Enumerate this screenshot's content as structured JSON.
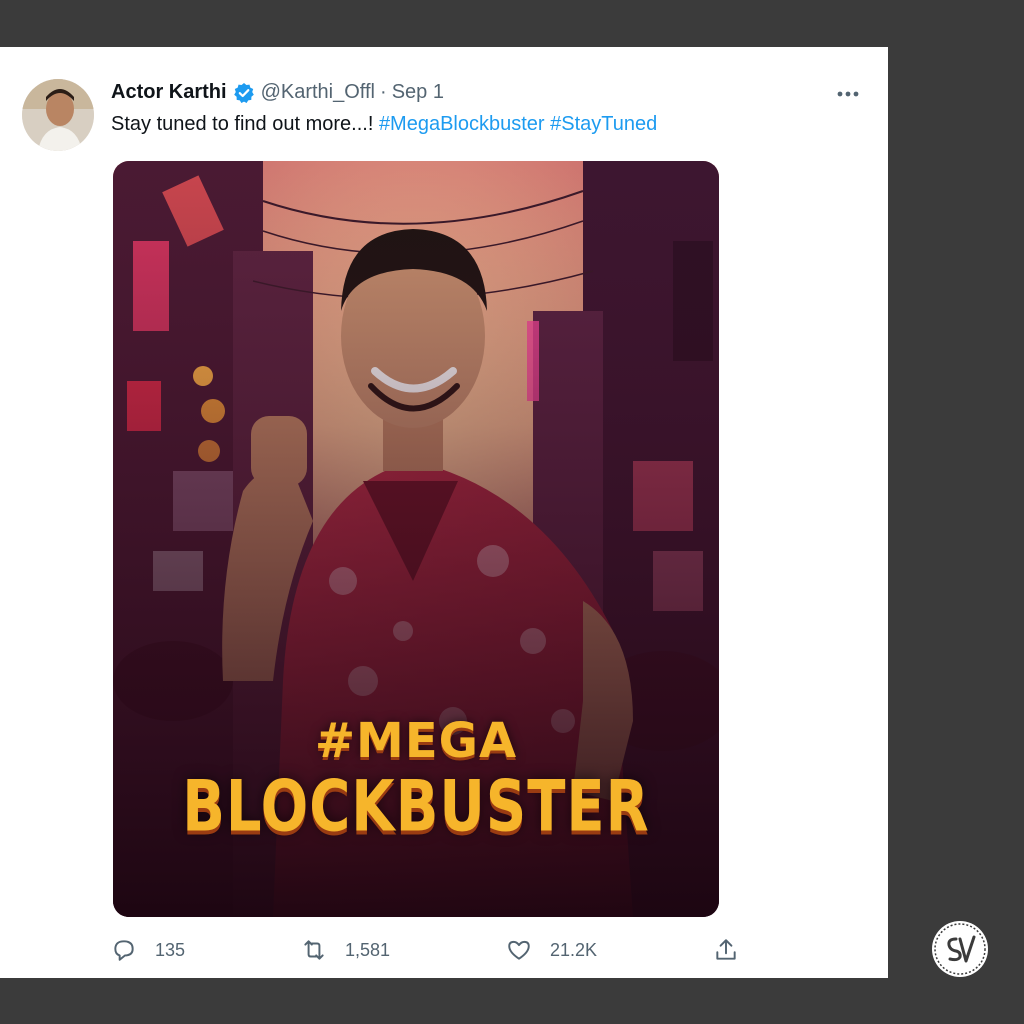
{
  "tweet": {
    "author_name": "Actor Karthi",
    "handle": "@Karthi_Offl",
    "separator": "·",
    "date": "Sep 1",
    "text_plain": "Stay tuned to find out more...! ",
    "hashtags": [
      "#MegaBlockbuster",
      "#StayTuned"
    ],
    "hashtag_space": " "
  },
  "poster": {
    "line1": "#MEGA",
    "line2": "BLOCKBUSTER"
  },
  "actions": {
    "replies": "135",
    "retweets": "1,581",
    "likes": "21.2K"
  },
  "colors": {
    "hashtag": "#1d9bf0",
    "muted": "#536471",
    "verified": "#1d9bf0",
    "frame": "#3b3b3b",
    "poster_title": "#f6b52b"
  },
  "icons": [
    "verified-badge-icon",
    "more-options-icon",
    "reply-icon",
    "retweet-icon",
    "like-icon",
    "share-icon",
    "sv-logo-icon"
  ]
}
